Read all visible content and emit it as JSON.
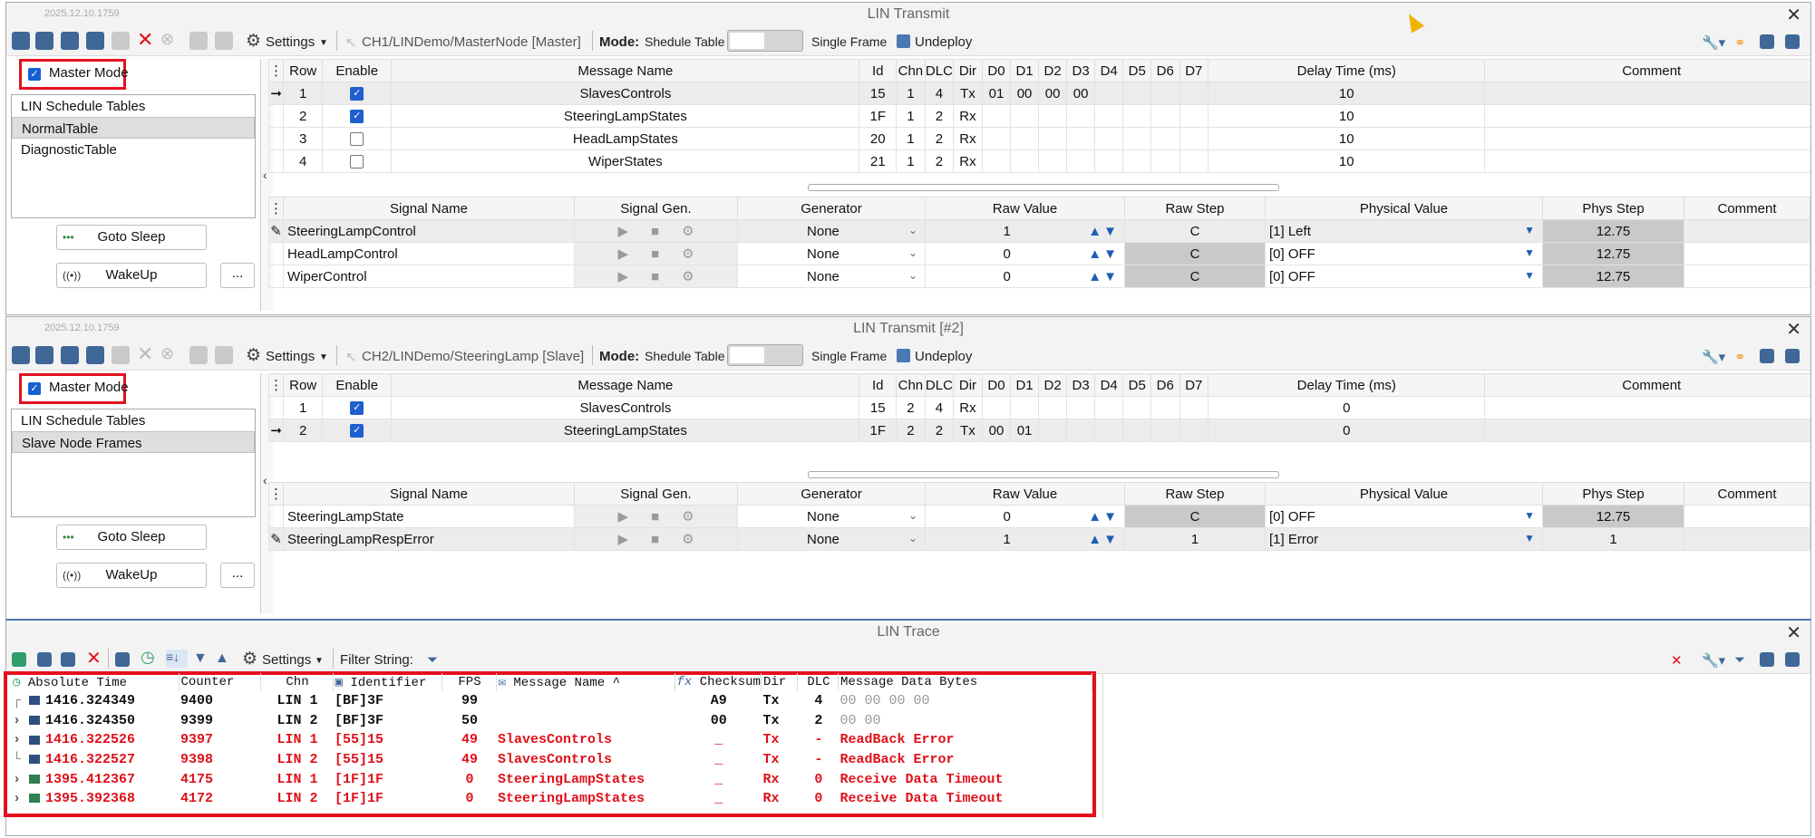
{
  "panel1": {
    "version": "2025.12.10.1759",
    "title": "LIN Transmit",
    "settings": "Settings",
    "path": "CH1/LINDemo/MasterNode [Master]",
    "mode_label": "Mode:",
    "mode_value": "Shedule Table",
    "single_frame": "Single Frame",
    "undeploy": "Undeploy",
    "master_mode": "Master Mode",
    "tree": [
      "LIN Schedule Tables",
      "NormalTable",
      "DiagnosticTable"
    ],
    "goto_sleep": "Goto Sleep",
    "wakeup": "WakeUp",
    "dots": "...",
    "msg_headers": [
      "Row",
      "Enable",
      "Message Name",
      "Id",
      "Chn",
      "DLC",
      "Dir",
      "D0",
      "D1",
      "D2",
      "D3",
      "D4",
      "D5",
      "D6",
      "D7",
      "Delay Time (ms)",
      "Comment"
    ],
    "messages": [
      {
        "row": "1",
        "enabled": true,
        "name": "SlavesControls",
        "id": "15",
        "chn": "1",
        "dlc": "4",
        "dir": "Tx",
        "d": [
          "01",
          "00",
          "00",
          "00",
          "",
          "",
          "",
          ""
        ],
        "delay": "10",
        "comment": ""
      },
      {
        "row": "2",
        "enabled": true,
        "name": "SteeringLampStates",
        "id": "1F",
        "chn": "1",
        "dlc": "2",
        "dir": "Rx",
        "d": [
          "",
          "",
          "",
          "",
          "",
          "",
          "",
          ""
        ],
        "delay": "10",
        "comment": ""
      },
      {
        "row": "3",
        "enabled": false,
        "name": "HeadLampStates",
        "id": "20",
        "chn": "1",
        "dlc": "2",
        "dir": "Rx",
        "d": [
          "",
          "",
          "",
          "",
          "",
          "",
          "",
          ""
        ],
        "delay": "10",
        "comment": ""
      },
      {
        "row": "4",
        "enabled": false,
        "name": "WiperStates",
        "id": "21",
        "chn": "1",
        "dlc": "2",
        "dir": "Rx",
        "d": [
          "",
          "",
          "",
          "",
          "",
          "",
          "",
          ""
        ],
        "delay": "10",
        "comment": ""
      }
    ],
    "sig_headers": [
      "Signal Name",
      "Signal Gen.",
      "Generator",
      "Raw Value",
      "Raw Step",
      "Physical Value",
      "Phys Step",
      "Comment"
    ],
    "signals": [
      {
        "name": "SteeringLampControl",
        "generator": "None",
        "raw": "1",
        "raw_step": "C",
        "phys": "[1] Left",
        "phys_step": "12.75",
        "comment": ""
      },
      {
        "name": "HeadLampControl",
        "generator": "None",
        "raw": "0",
        "raw_step": "C",
        "phys": "[0] OFF",
        "phys_step": "12.75",
        "comment": ""
      },
      {
        "name": "WiperControl",
        "generator": "None",
        "raw": "0",
        "raw_step": "C",
        "phys": "[0] OFF",
        "phys_step": "12.75",
        "comment": ""
      }
    ]
  },
  "panel2": {
    "version": "2025.12.10.1759",
    "title": "LIN Transmit [#2]",
    "settings": "Settings",
    "path": "CH2/LINDemo/SteeringLamp [Slave]",
    "mode_label": "Mode:",
    "mode_value": "Shedule Table",
    "single_frame": "Single Frame",
    "undeploy": "Undeploy",
    "master_mode": "Master Mode",
    "tree": [
      "LIN Schedule Tables",
      "Slave Node Frames"
    ],
    "goto_sleep": "Goto Sleep",
    "wakeup": "WakeUp",
    "dots": "...",
    "msg_headers": [
      "Row",
      "Enable",
      "Message Name",
      "Id",
      "Chn",
      "DLC",
      "Dir",
      "D0",
      "D1",
      "D2",
      "D3",
      "D4",
      "D5",
      "D6",
      "D7",
      "Delay Time (ms)",
      "Comment"
    ],
    "messages": [
      {
        "row": "1",
        "enabled": true,
        "name": "SlavesControls",
        "id": "15",
        "chn": "2",
        "dlc": "4",
        "dir": "Rx",
        "d": [
          "",
          "",
          "",
          "",
          "",
          "",
          "",
          ""
        ],
        "delay": "0",
        "comment": ""
      },
      {
        "row": "2",
        "enabled": true,
        "name": "SteeringLampStates",
        "id": "1F",
        "chn": "2",
        "dlc": "2",
        "dir": "Tx",
        "d": [
          "00",
          "01",
          "",
          "",
          "",
          "",
          "",
          ""
        ],
        "delay": "0",
        "comment": ""
      }
    ],
    "sig_headers": [
      "Signal Name",
      "Signal Gen.",
      "Generator",
      "Raw Value",
      "Raw Step",
      "Physical Value",
      "Phys Step",
      "Comment"
    ],
    "signals": [
      {
        "name": "SteeringLampState",
        "generator": "None",
        "raw": "0",
        "raw_step": "C",
        "phys": "[0] OFF",
        "phys_step": "12.75",
        "comment": ""
      },
      {
        "name": "SteeringLampRespError",
        "generator": "None",
        "raw": "1",
        "raw_step": "1",
        "phys": "[1] Error",
        "phys_step": "1",
        "comment": ""
      }
    ]
  },
  "trace": {
    "title": "LIN Trace",
    "settings": "Settings",
    "filter": "Filter String:",
    "headers": [
      "Absolute Time",
      "Counter",
      "Chn",
      "Identifier",
      "FPS",
      "Message Name",
      "Checksum",
      "Dir",
      "DLC",
      "Message Data Bytes"
    ],
    "rows": [
      {
        "time": "1416.324349",
        "counter": "9400",
        "chn": "LIN 1",
        "id": "[BF]3F",
        "fps": "99",
        "name": "",
        "checksum": "A9",
        "dir": "Tx",
        "dlc": "4",
        "data": "00 00 00 00",
        "error": false
      },
      {
        "time": "1416.324350",
        "counter": "9399",
        "chn": "LIN 2",
        "id": "[BF]3F",
        "fps": "50",
        "name": "",
        "checksum": "00",
        "dir": "Tx",
        "dlc": "2",
        "data": "00 00",
        "error": false
      },
      {
        "time": "1416.322526",
        "counter": "9397",
        "chn": "LIN 1",
        "id": "[55]15",
        "fps": "49",
        "name": "SlavesControls",
        "checksum": "_",
        "dir": "Tx",
        "dlc": "-",
        "data": "ReadBack Error",
        "error": true
      },
      {
        "time": "1416.322527",
        "counter": "9398",
        "chn": "LIN 2",
        "id": "[55]15",
        "fps": "49",
        "name": "SlavesControls",
        "checksum": "_",
        "dir": "Tx",
        "dlc": "-",
        "data": "ReadBack Error",
        "error": true
      },
      {
        "time": "1395.412367",
        "counter": "4175",
        "chn": "LIN 1",
        "id": "[1F]1F",
        "fps": "0",
        "name": "SteeringLampStates",
        "checksum": "_",
        "dir": "Rx",
        "dlc": "0",
        "data": "Receive Data Timeout",
        "error": true
      },
      {
        "time": "1395.392368",
        "counter": "4172",
        "chn": "LIN 2",
        "id": "[1F]1F",
        "fps": "0",
        "name": "SteeringLampStates",
        "checksum": "_",
        "dir": "Rx",
        "dlc": "0",
        "data": "Receive Data Timeout",
        "error": true
      }
    ]
  }
}
